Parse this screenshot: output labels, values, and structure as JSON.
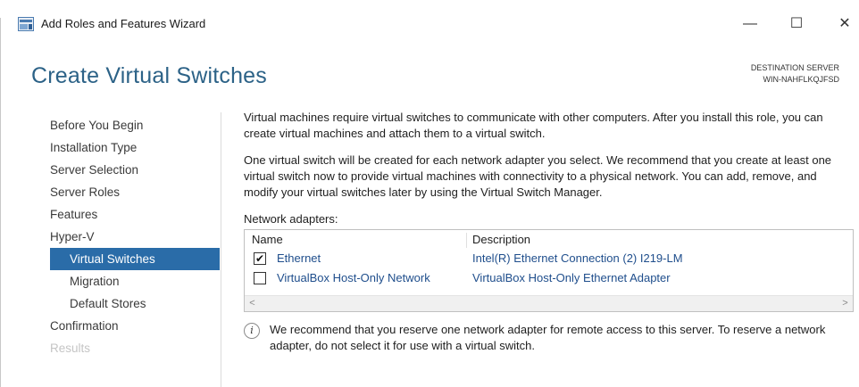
{
  "window": {
    "title": "Add Roles and Features Wizard",
    "controls": {
      "minimize": "—",
      "maximize": "☐",
      "close": "✕"
    }
  },
  "page": {
    "title": "Create Virtual Switches",
    "destination_label": "DESTINATION SERVER",
    "destination_server": "WIN-NAHFLKQJFSD"
  },
  "nav": {
    "items": [
      {
        "label": "Before You Begin",
        "state": "normal"
      },
      {
        "label": "Installation Type",
        "state": "normal"
      },
      {
        "label": "Server Selection",
        "state": "normal"
      },
      {
        "label": "Server Roles",
        "state": "normal"
      },
      {
        "label": "Features",
        "state": "normal"
      },
      {
        "label": "Hyper-V",
        "state": "normal"
      },
      {
        "label": "Virtual Switches",
        "state": "active"
      },
      {
        "label": "Migration",
        "state": "normal"
      },
      {
        "label": "Default Stores",
        "state": "normal"
      },
      {
        "label": "Confirmation",
        "state": "normal"
      },
      {
        "label": "Results",
        "state": "disabled"
      }
    ]
  },
  "content": {
    "para1": "Virtual machines require virtual switches to communicate with other computers. After you install this role, you can create virtual machines and attach them to a virtual switch.",
    "para2": "One virtual switch will be created for each network adapter you select. We recommend that you create at least one virtual switch now to provide virtual machines with connectivity to a physical network. You can add, remove, and modify your virtual switches later by using the Virtual Switch Manager.",
    "adapters_label": "Network adapters:"
  },
  "table": {
    "columns": {
      "name": "Name",
      "description": "Description"
    },
    "rows": [
      {
        "checked": true,
        "check_glyph": "✔",
        "name": "Ethernet",
        "description": "Intel(R) Ethernet Connection (2) I219-LM"
      },
      {
        "checked": false,
        "check_glyph": "",
        "name": "VirtualBox Host-Only Network",
        "description": "VirtualBox Host-Only Ethernet Adapter"
      }
    ],
    "scroll_left": "<",
    "scroll_right": ">"
  },
  "info": {
    "icon_glyph": "i",
    "text": "We recommend that you reserve one network adapter for remote access to this server. To reserve a network adapter, do not select it for use with a virtual switch."
  },
  "colors": {
    "title_blue": "#2c6287",
    "nav_selected_bg": "#2a6ca8",
    "link_blue": "#1f4e8c",
    "disabled_text": "#c5c5c5"
  }
}
